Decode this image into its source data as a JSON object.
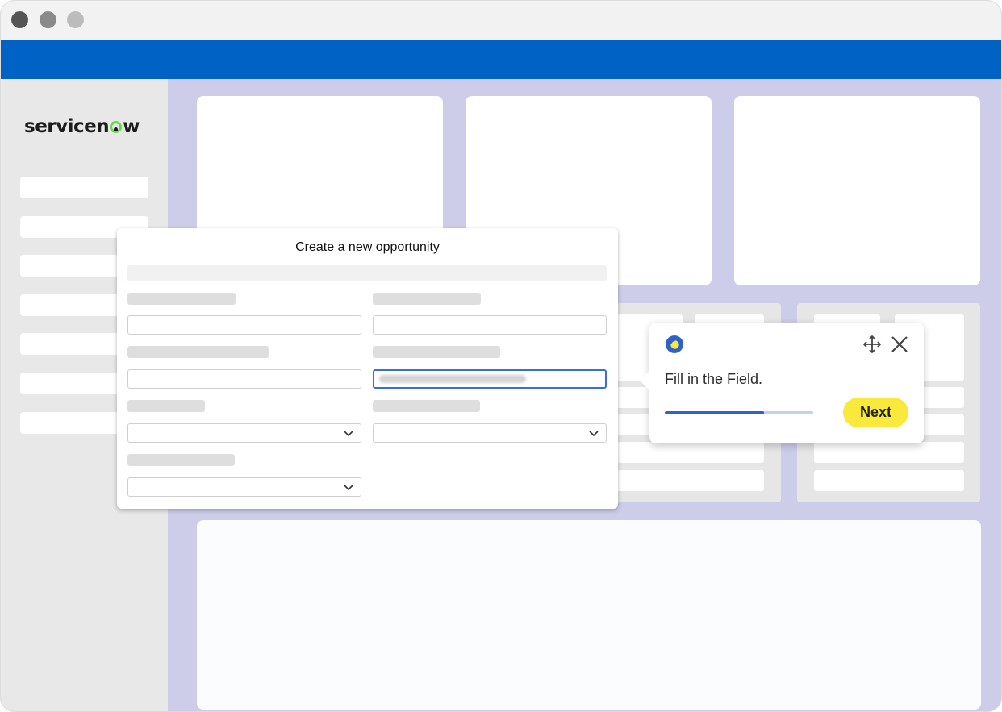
{
  "window": {
    "controls": [
      "close-dot",
      "minimize-dot",
      "maximize-dot"
    ]
  },
  "header": {
    "color": "#0062c4"
  },
  "sidebar": {
    "logo_text_before": "servicen",
    "logo_text_after": "w",
    "logo_accent": "#62d84e"
  },
  "modal": {
    "title": "Create a new opportunity",
    "active_field": "field-right-2"
  },
  "tooltip": {
    "message": "Fill in the Field.",
    "next_label": "Next",
    "progress": 0.67,
    "accent_color": "#f8e93c",
    "progress_color": "#2f62c8",
    "icons": [
      "brand-icon",
      "move-icon",
      "close-icon"
    ]
  }
}
